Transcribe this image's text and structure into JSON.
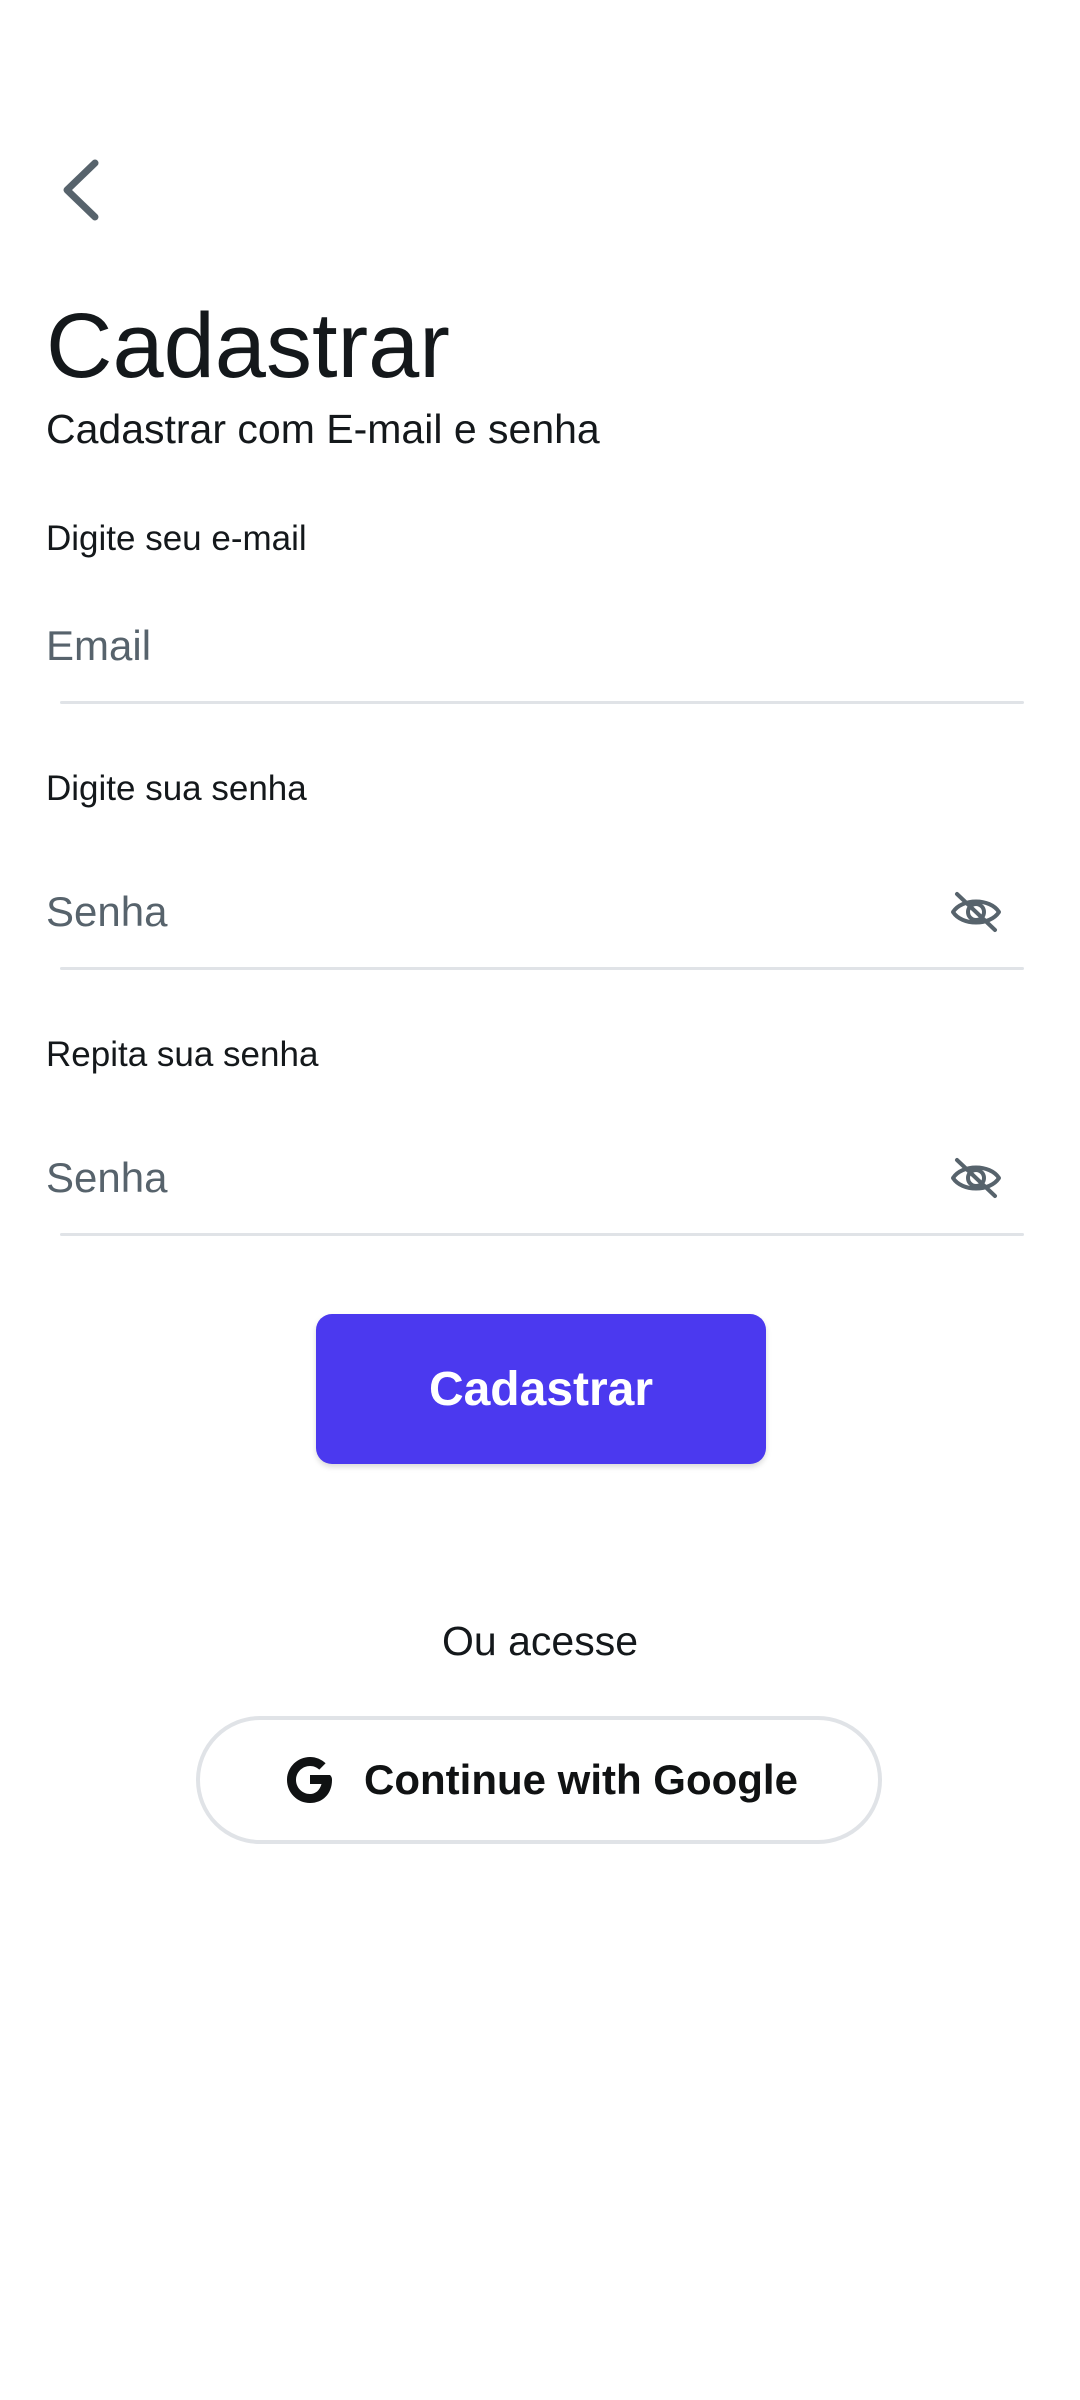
{
  "header": {
    "back_icon": "chevron-left-icon",
    "title": "Cadastrar",
    "subtitle": "Cadastrar com E-mail e senha"
  },
  "form": {
    "email": {
      "label": "Digite seu e-mail",
      "placeholder": "Email",
      "value": ""
    },
    "password": {
      "label": "Digite sua senha",
      "placeholder": "Senha",
      "value": "",
      "toggle_icon": "eye-off-icon"
    },
    "confirm_password": {
      "label": "Repita sua senha",
      "placeholder": "Senha",
      "value": "",
      "toggle_icon": "eye-off-icon"
    },
    "submit_label": "Cadastrar"
  },
  "alternate": {
    "or_text": "Ou acesse",
    "google_label": "Continue with Google",
    "google_icon": "google-icon"
  },
  "colors": {
    "primary": "#4b39ef",
    "primary_text": "#14181b",
    "secondary_text": "#57636c",
    "divider": "#e0e3e7",
    "background": "#ffffff"
  }
}
